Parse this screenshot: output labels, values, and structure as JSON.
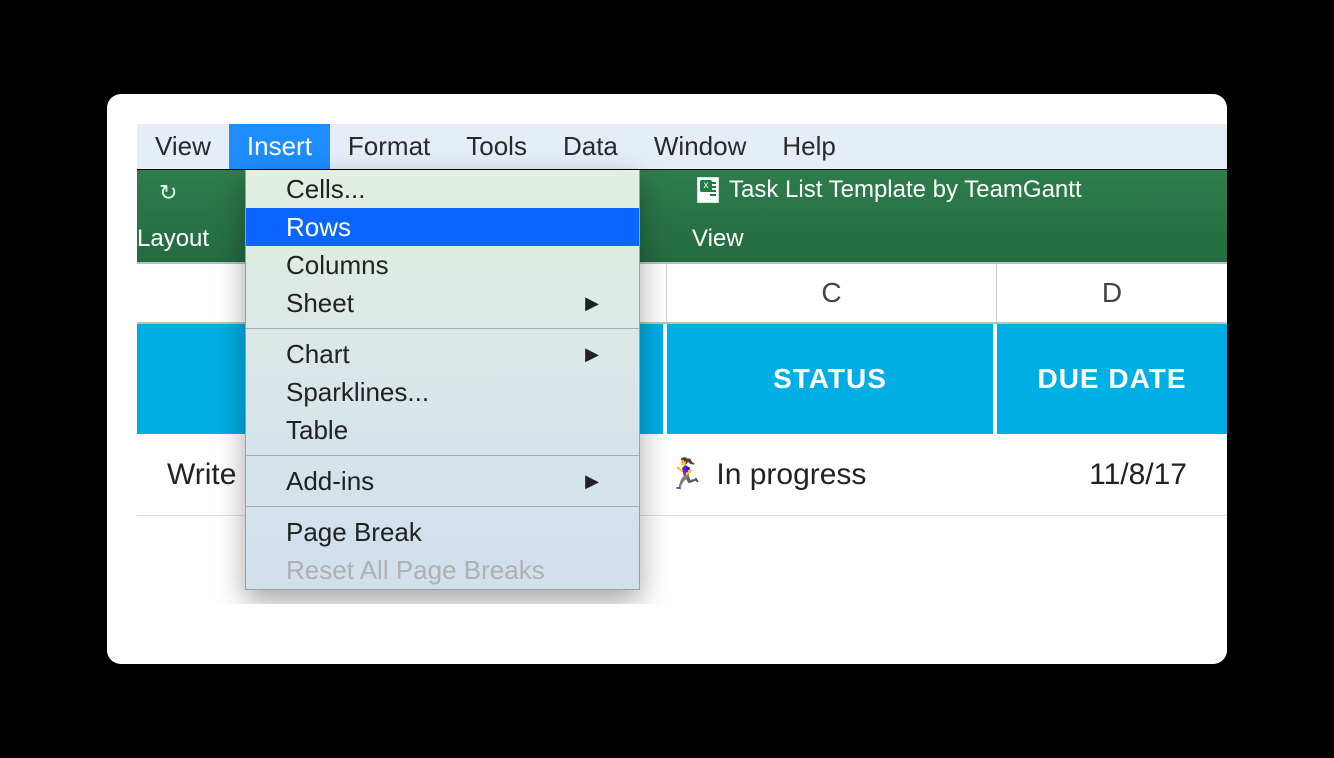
{
  "menubar": {
    "items": [
      "View",
      "Insert",
      "Format",
      "Tools",
      "Data",
      "Window",
      "Help"
    ],
    "active_index": 1
  },
  "dropdown": {
    "groups": [
      [
        {
          "label": "Cells...",
          "submenu": false
        },
        {
          "label": "Rows",
          "submenu": false,
          "selected": true
        },
        {
          "label": "Columns",
          "submenu": false
        },
        {
          "label": "Sheet",
          "submenu": true
        }
      ],
      [
        {
          "label": "Chart",
          "submenu": true
        },
        {
          "label": "Sparklines...",
          "submenu": false
        },
        {
          "label": "Table",
          "submenu": false
        }
      ],
      [
        {
          "label": "Add-ins",
          "submenu": true
        }
      ],
      [
        {
          "label": "Page Break",
          "submenu": false
        },
        {
          "label": "Reset All Page Breaks",
          "submenu": false,
          "disabled": true
        }
      ]
    ]
  },
  "toolbar": {
    "doc_title": "Task List Template by TeamGantt",
    "left_group_label": "Layout",
    "right_group_label": "View"
  },
  "columns": {
    "c": "C",
    "d": "D"
  },
  "sheet_headers": {
    "status": "STATUS",
    "due_date": "DUE DATE"
  },
  "data_row": {
    "task": "Write",
    "status_emoji": "🏃‍♀️",
    "status_text": "In progress",
    "due_date": "11/8/17"
  }
}
